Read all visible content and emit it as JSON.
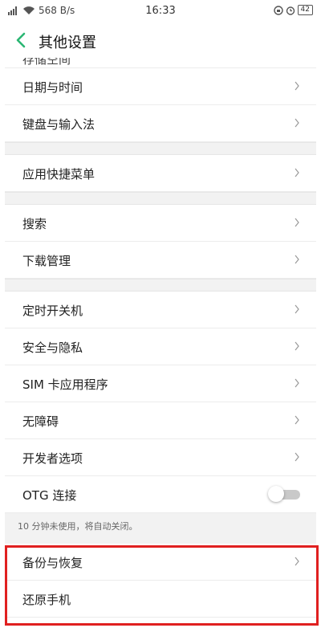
{
  "status_bar": {
    "network_speed": "568 B/s",
    "time": "16:33",
    "battery": "42"
  },
  "header": {
    "title": "其他设置"
  },
  "items": {
    "partial": "存储空间",
    "date_time": "日期与时间",
    "keyboard": "键盘与输入法",
    "shortcut_menu": "应用快捷菜单",
    "search": "搜索",
    "download": "下载管理",
    "scheduled_power": "定时开关机",
    "security_privacy": "安全与隐私",
    "sim_apps": "SIM 卡应用程序",
    "accessibility": "无障碍",
    "developer": "开发者选项",
    "otg": "OTG 连接",
    "otg_note": "10 分钟未使用，将自动关闭。",
    "backup_restore": "备份与恢复",
    "reset_phone": "还原手机"
  },
  "toggles": {
    "otg_enabled": false
  },
  "colors": {
    "accent": "#2bb673",
    "highlight": "#e02020"
  }
}
